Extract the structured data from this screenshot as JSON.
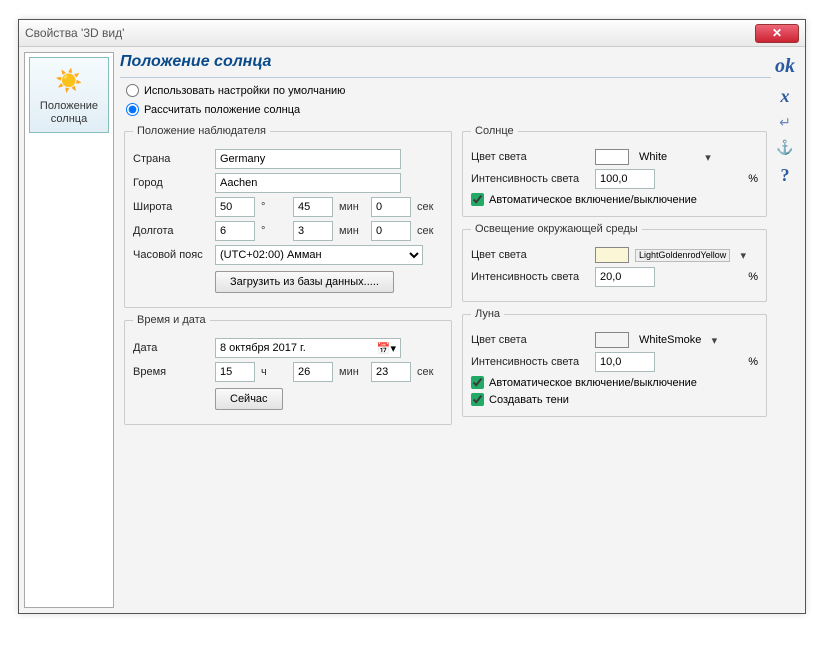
{
  "window": {
    "title": "Свойства '3D вид'"
  },
  "sidebar": {
    "item": {
      "label": "Положение солнца"
    }
  },
  "page": {
    "title": "Положение солнца"
  },
  "mode": {
    "default_label": "Использовать настройки по умолчанию",
    "calc_label": "Рассчитать положение солнца"
  },
  "observer": {
    "legend": "Положение наблюдателя",
    "country_label": "Страна",
    "country": "Germany",
    "city_label": "Город",
    "city": "Aachen",
    "lat_label": "Широта",
    "lat_deg": "50",
    "lat_min": "45",
    "lat_sec": "0",
    "lon_label": "Долгота",
    "lon_deg": "6",
    "lon_min": "3",
    "lon_sec": "0",
    "deg_unit": "°",
    "min_unit": "мин",
    "sec_unit": "сек",
    "tz_label": "Часовой пояс",
    "tz": "(UTC+02:00) Амман",
    "load_btn": "Загрузить из базы данных....."
  },
  "datetime": {
    "legend": "Время и дата",
    "date_label": "Дата",
    "date": "8  октября  2017 г.",
    "time_label": "Время",
    "h": "15",
    "m": "26",
    "s": "23",
    "h_unit": "ч",
    "m_unit": "мин",
    "s_unit": "сек",
    "now_btn": "Сейчас"
  },
  "sun": {
    "legend": "Солнце",
    "color_label": "Цвет света",
    "color_name": "White",
    "intensity_label": "Интенсивность света",
    "intensity": "100,0",
    "pct": "%",
    "auto_label": "Автоматическое включение/выключение"
  },
  "ambient": {
    "legend": "Освещение окружающей среды",
    "color_label": "Цвет света",
    "color_name": "LightGoldenrodYellow",
    "intensity_label": "Интенсивность света",
    "intensity": "20,0",
    "pct": "%"
  },
  "moon": {
    "legend": "Луна",
    "color_label": "Цвет света",
    "color_name": "WhiteSmoke",
    "intensity_label": "Интенсивность света",
    "intensity": "10,0",
    "pct": "%",
    "auto_label": "Автоматическое включение/выключение",
    "shadow_label": "Создавать тени"
  },
  "actions": {
    "ok": "ok",
    "cancel": "x",
    "enter": "↵",
    "anchor": "⚓",
    "help": "?"
  }
}
